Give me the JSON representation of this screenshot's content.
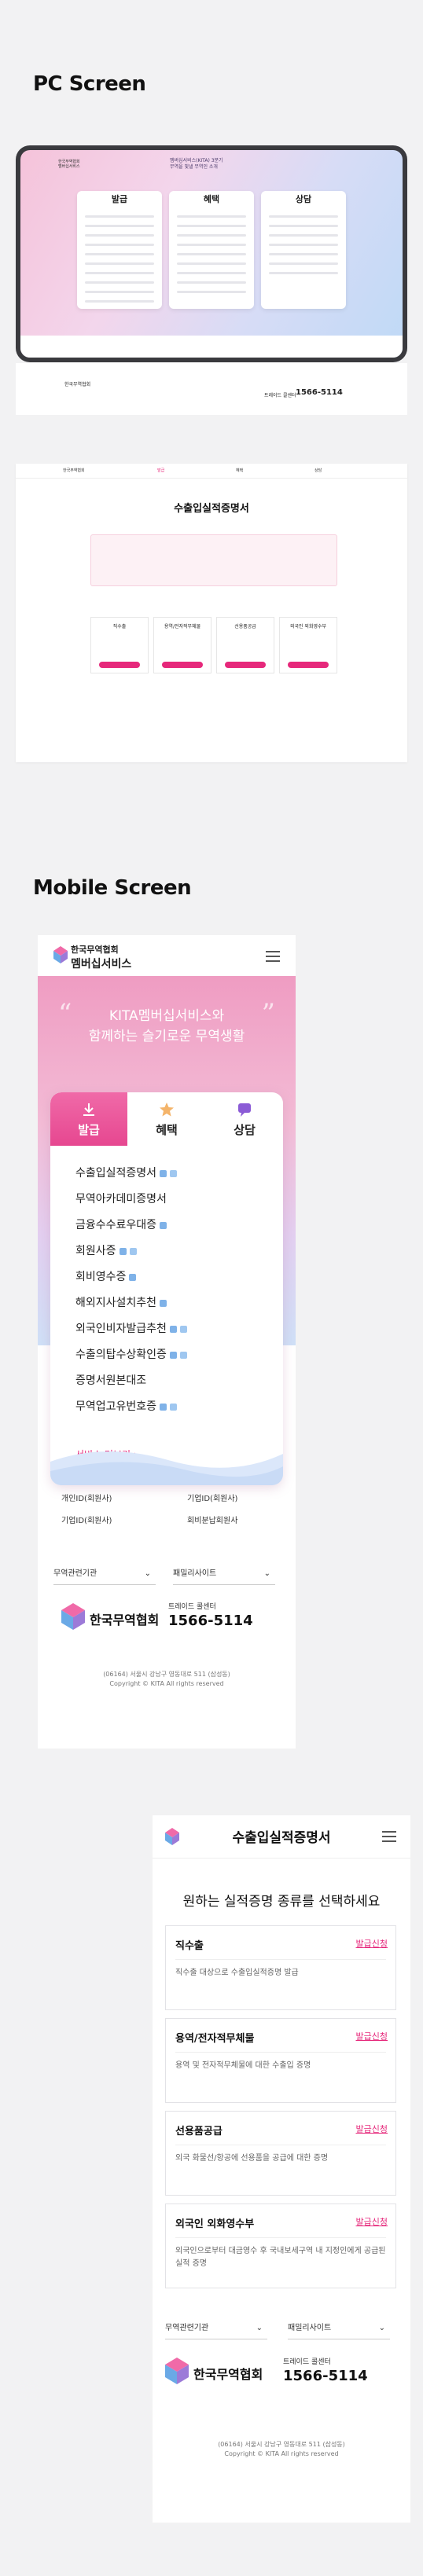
{
  "sections": {
    "pc": "PC Screen",
    "mobile": "Mobile Screen"
  },
  "pc_home": {
    "banner": "멤버십서비스(KITA) 3분기",
    "banner_sub": "무역을 빛낼 무역인 소개",
    "tabs": [
      "발급",
      "혜택",
      "상담"
    ]
  },
  "pc_cert": {
    "title": "수출입실적증명서",
    "types": [
      "직수출",
      "용역/전자적무체물",
      "선용품공급",
      "외국인 외화영수부"
    ]
  },
  "mobile_home": {
    "brand": "한국무역협회",
    "brand_sub": "멤버십서비스",
    "hero_line1": "KITA멤버십서비스와",
    "hero_line2": "함께하는 슬기로운 무역생활",
    "tabs": [
      {
        "label": "발급"
      },
      {
        "label": "혜택"
      },
      {
        "label": "상담"
      }
    ],
    "items": [
      {
        "label": "수출입실적증명서"
      },
      {
        "label": "무역아카데미증명서"
      },
      {
        "label": "금융수수료우대증"
      },
      {
        "label": "회원사증"
      },
      {
        "label": "회비영수증"
      },
      {
        "label": "해외지사설치추천"
      },
      {
        "label": "외국인비자발급추천"
      },
      {
        "label": "수출의탑수상확인증"
      },
      {
        "label": "증명서원본대조"
      },
      {
        "label": "무역업고유번호증"
      }
    ],
    "more": "서비스 더보기",
    "quick": [
      "개인ID(회원사)",
      "기업ID(회원사)",
      "기업ID(회원사)",
      "회비분납회원사"
    ],
    "select1": "무역관련기관",
    "select2": "패밀리사이트",
    "corp_name": "한국무역협회",
    "hotline_label": "트레이드 콜센터",
    "hotline": "1566-5114",
    "address": "(06164) 서울시 강남구 영동대로 511 (삼성동)",
    "copyright": "Copyright © KITA All rights reserved"
  },
  "mobile_cert": {
    "title": "수출입실적증명서",
    "subtitle": "원하는 실적증명 종류를 선택하세요",
    "cards": [
      {
        "title": "직수출",
        "link": "발급신청",
        "desc": "직수출 대상으로 수출입실적증명 발급"
      },
      {
        "title": "용역/전자적무체물",
        "link": "발급신청",
        "desc": "용역 및 전자적무체물에 대한 수출입 증명"
      },
      {
        "title": "선용품공급",
        "link": "발급신청",
        "desc": "외국 화물선/항공에 선용품을 공급에 대한 증명"
      },
      {
        "title": "외국인 외화영수부",
        "link": "발급신청",
        "desc": "외국인으로부터 대금영수 후 국내보세구역 내 지정인에게 공급된 실적 증명"
      }
    ],
    "select1": "무역관련기관",
    "select2": "패밀리사이트",
    "corp_name": "한국무역협회",
    "hotline_label": "트레이드 콜센터",
    "hotline": "1566-5114",
    "address": "(06164) 서울시 강남구 영동대로 511 (삼성동)",
    "copyright": "Copyright © KITA All rights reserved"
  },
  "colors": {
    "accent": "#e6287b",
    "pink": "#f06aa8",
    "bg": "#f2f2f3"
  }
}
